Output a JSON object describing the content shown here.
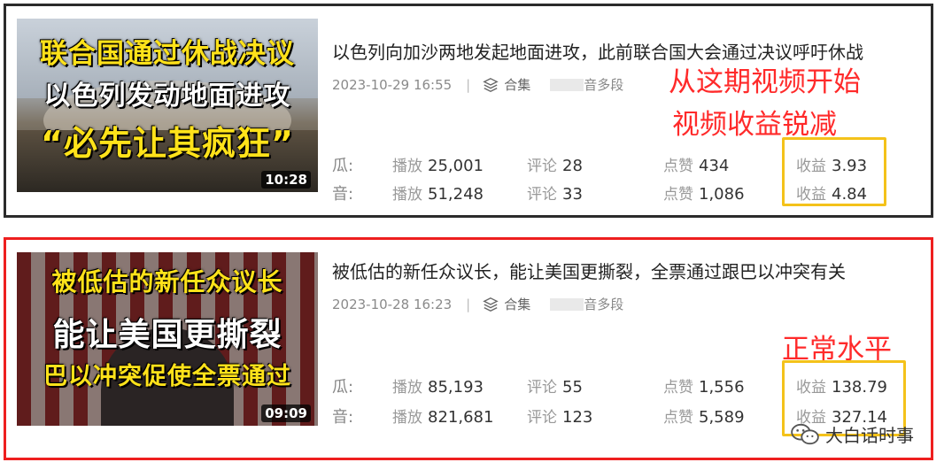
{
  "cards": [
    {
      "thumb_lines": [
        "联合国通过休战决议",
        "以色列发动地面进攻",
        "“必先让其疯狂”"
      ],
      "duration": "10:28",
      "title": "以色列向加沙两地发起地面进攻，此前联合国大会通过决议呼吁休战",
      "date": "2023-10-29 16:55",
      "separator": "|",
      "collection_label": "合集",
      "multi_label": "音多段",
      "annotations": [
        "从这期视频开始",
        "视频收益锐减"
      ],
      "rows": [
        {
          "platform": "瓜:",
          "play_label": "播放",
          "play": "25,001",
          "comment_label": "评论",
          "comment": "28",
          "like_label": "点赞",
          "like": "434",
          "income_label": "收益",
          "income": "3.93"
        },
        {
          "platform": "音:",
          "play_label": "播放",
          "play": "51,248",
          "comment_label": "评论",
          "comment": "33",
          "like_label": "点赞",
          "like": "1,086",
          "income_label": "收益",
          "income": "4.84"
        }
      ]
    },
    {
      "thumb_lines": [
        "被低估的新任众议长",
        "能让美国更撕裂",
        "巴以冲突促使全票通过"
      ],
      "duration": "09:09",
      "title": "被低估的新任众议长，能让美国更撕裂，全票通过跟巴以冲突有关",
      "date": "2023-10-28 16:23",
      "separator": "|",
      "collection_label": "合集",
      "multi_label": "音多段",
      "annotations": [
        "正常水平"
      ],
      "rows": [
        {
          "platform": "瓜:",
          "play_label": "播放",
          "play": "85,193",
          "comment_label": "评论",
          "comment": "55",
          "like_label": "点赞",
          "like": "1,556",
          "income_label": "收益",
          "income": "138.79"
        },
        {
          "platform": "音:",
          "play_label": "播放",
          "play": "821,681",
          "comment_label": "评论",
          "comment": "123",
          "like_label": "点赞",
          "like": "5,589",
          "income_label": "收益",
          "income": "327.14"
        }
      ]
    }
  ],
  "watermark": "大白话时事",
  "colors": {
    "annotation": "#ff2a2a",
    "highlight_box": "#f4c21a",
    "card2_border": "#ee1f1f",
    "card1_border": "#2b2b2b"
  },
  "icons": {
    "collection": "layers-icon",
    "watermark": "wechat-icon"
  }
}
